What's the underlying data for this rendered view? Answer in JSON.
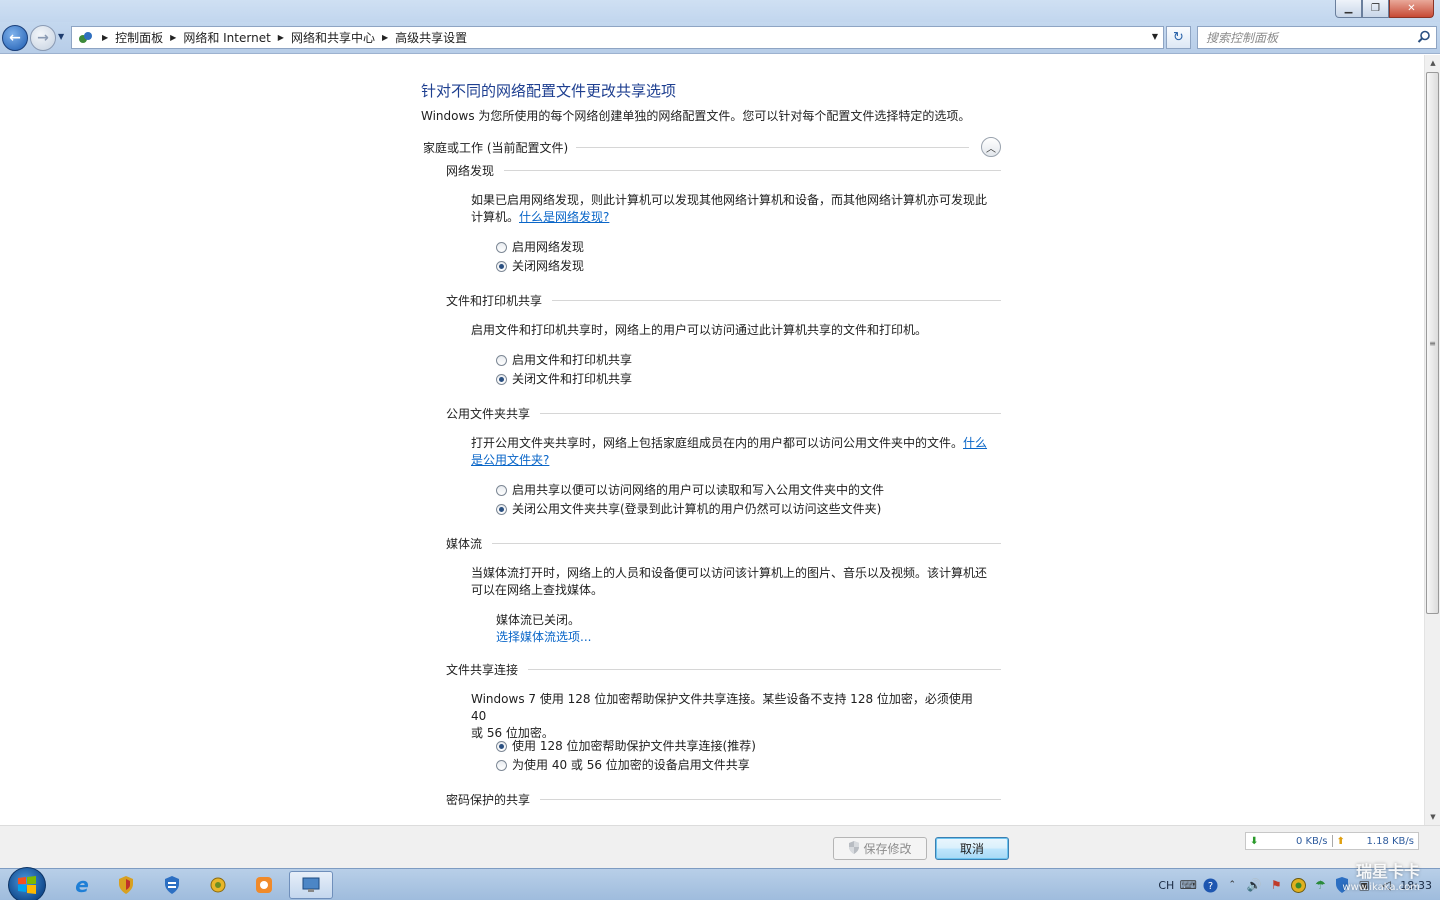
{
  "nav": {
    "breadcrumbs": [
      "控制面板",
      "网络和 Internet",
      "网络和共享中心",
      "高级共享设置"
    ],
    "search_placeholder": "搜索控制面板"
  },
  "page": {
    "title": "针对不同的网络配置文件更改共享选项",
    "description": "Windows 为您所使用的每个网络创建单独的网络配置文件。您可以针对每个配置文件选择特定的选项。",
    "profile_label": "家庭或工作 (当前配置文件)"
  },
  "sections": {
    "discovery": {
      "title": "网络发现",
      "desc_line1": "如果已启用网络发现，则此计算机可以发现其他网络计算机和设备，而其他网络计算机亦可发现此",
      "desc_line2": "计算机。",
      "link": "什么是网络发现?",
      "options": [
        "启用网络发现",
        "关闭网络发现"
      ],
      "selected": 1
    },
    "file_printer": {
      "title": "文件和打印机共享",
      "desc": "启用文件和打印机共享时，网络上的用户可以访问通过此计算机共享的文件和打印机。",
      "options": [
        "启用文件和打印机共享",
        "关闭文件和打印机共享"
      ],
      "selected": 1
    },
    "public_folder": {
      "title": "公用文件夹共享",
      "desc": "打开公用文件夹共享时，网络上包括家庭组成员在内的用户都可以访问公用文件夹中的文件。",
      "link_part1": "什么",
      "link_part2": "是公用文件夹?",
      "options": [
        "启用共享以便可以访问网络的用户可以读取和写入公用文件夹中的文件",
        "关闭公用文件夹共享(登录到此计算机的用户仍然可以访问这些文件夹)"
      ],
      "selected": 1
    },
    "media": {
      "title": "媒体流",
      "desc_line1": "当媒体流打开时，网络上的人员和设备便可以访问该计算机上的图片、音乐以及视频。该计算机还",
      "desc_line2": "可以在网络上查找媒体。",
      "status": "媒体流已关闭。",
      "link": "选择媒体流选项..."
    },
    "encryption": {
      "title": "文件共享连接",
      "desc_line1": "Windows 7 使用 128 位加密帮助保护文件共享连接。某些设备不支持 128 位加密，必须使用 40",
      "desc_line2": "或 56 位加密。",
      "options": [
        "使用 128 位加密帮助保护文件共享连接(推荐)",
        "为使用 40 或 56 位加密的设备启用文件共享"
      ],
      "selected": 0
    },
    "password": {
      "title": "密码保护的共享"
    }
  },
  "footer": {
    "save_label": "保存修改",
    "cancel_label": "取消",
    "download_speed": "0 KB/s",
    "upload_speed": "1.18 KB/s"
  },
  "watermark": {
    "brand": "瑞星卡卡",
    "url": "www.ikaka.com"
  },
  "taskbar": {
    "lang": "CH",
    "time": "18:33"
  },
  "colors": {
    "title_blue": "#1e3f90",
    "link_blue": "#0a66c8"
  }
}
